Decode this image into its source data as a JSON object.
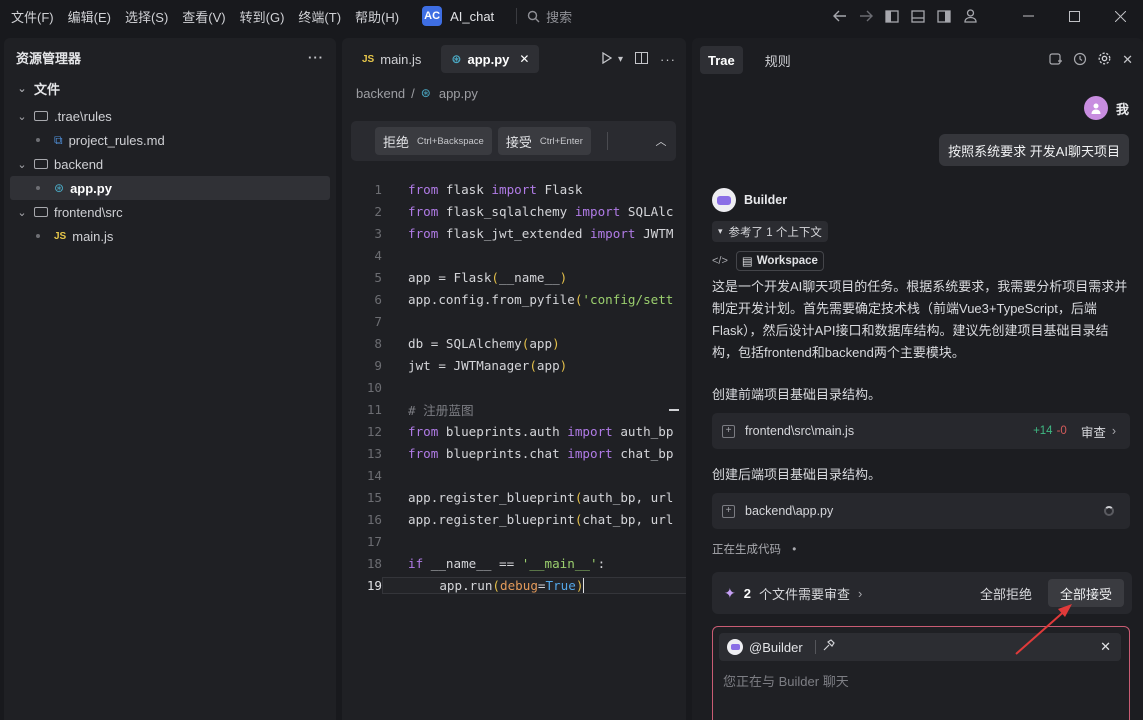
{
  "menu": [
    "文件(F)",
    "编辑(E)",
    "选择(S)",
    "查看(V)",
    "转到(G)",
    "终端(T)",
    "帮助(H)"
  ],
  "app": {
    "badge": "AC",
    "name": "AI_chat"
  },
  "search_placeholder": "搜索",
  "explorer": {
    "title": "资源管理器",
    "section": "文件",
    "items": [
      {
        "label": ".trae\\rules",
        "kind": "folder"
      },
      {
        "label": "project_rules.md",
        "kind": "md"
      },
      {
        "label": "backend",
        "kind": "folder"
      },
      {
        "label": "app.py",
        "kind": "py"
      },
      {
        "label": "frontend\\src",
        "kind": "folder"
      },
      {
        "label": "main.js",
        "kind": "js"
      }
    ]
  },
  "editor": {
    "tabs": [
      {
        "icon": "JS",
        "label": "main.js"
      },
      {
        "icon": "py",
        "label": "app.py"
      }
    ],
    "breadcrumb": [
      "backend",
      "app.py"
    ],
    "diff": {
      "reject_label": "拒绝",
      "reject_shortcut": "Ctrl+Backspace",
      "accept_label": "接受",
      "accept_shortcut": "Ctrl+Enter"
    },
    "line_numbers": [
      "1",
      "2",
      "3",
      "4",
      "5",
      "6",
      "7",
      "8",
      "9",
      "10",
      "11",
      "12",
      "13",
      "14",
      "15",
      "16",
      "17",
      "18",
      "19"
    ],
    "current_line": "19"
  },
  "chat": {
    "tabs": [
      "Trae",
      "规则"
    ],
    "user_name": "我",
    "user_message": "按照系统要求 开发AI聊天项目",
    "bot_name": "Builder",
    "context_label": "参考了 1 个上下文",
    "workspace_label": "Workspace",
    "response": "这是一个开发AI聊天项目的任务。根据系统要求，我需要分析项目需求并制定开发计划。首先需要确定技术栈（前端Vue3+TypeScript，后端Flask），然后设计API接口和数据库结构。建议先创建项目基础目录结构，包括frontend和backend两个主要模块。",
    "step1": "创建前端项目基础目录结构。",
    "file1": {
      "path": "frontend\\src\\main.js",
      "added": "+14",
      "removed": "-0",
      "action": "审查"
    },
    "step2": "创建后端项目基础目录结构。",
    "file2": {
      "path": "backend\\app.py"
    },
    "status": "正在生成代码",
    "status_dot": "•",
    "pending": {
      "count": "2",
      "label": "个文件需要审查",
      "reject_all": "全部拒绝",
      "accept_all": "全部接受"
    },
    "input": {
      "mention": "@Builder",
      "placeholder": "您正在与 Builder 聊天"
    }
  },
  "colors": {
    "accent": "#3e6ee3",
    "input_border": "#c95c73",
    "annotation_arrow": "#e03a3a"
  }
}
